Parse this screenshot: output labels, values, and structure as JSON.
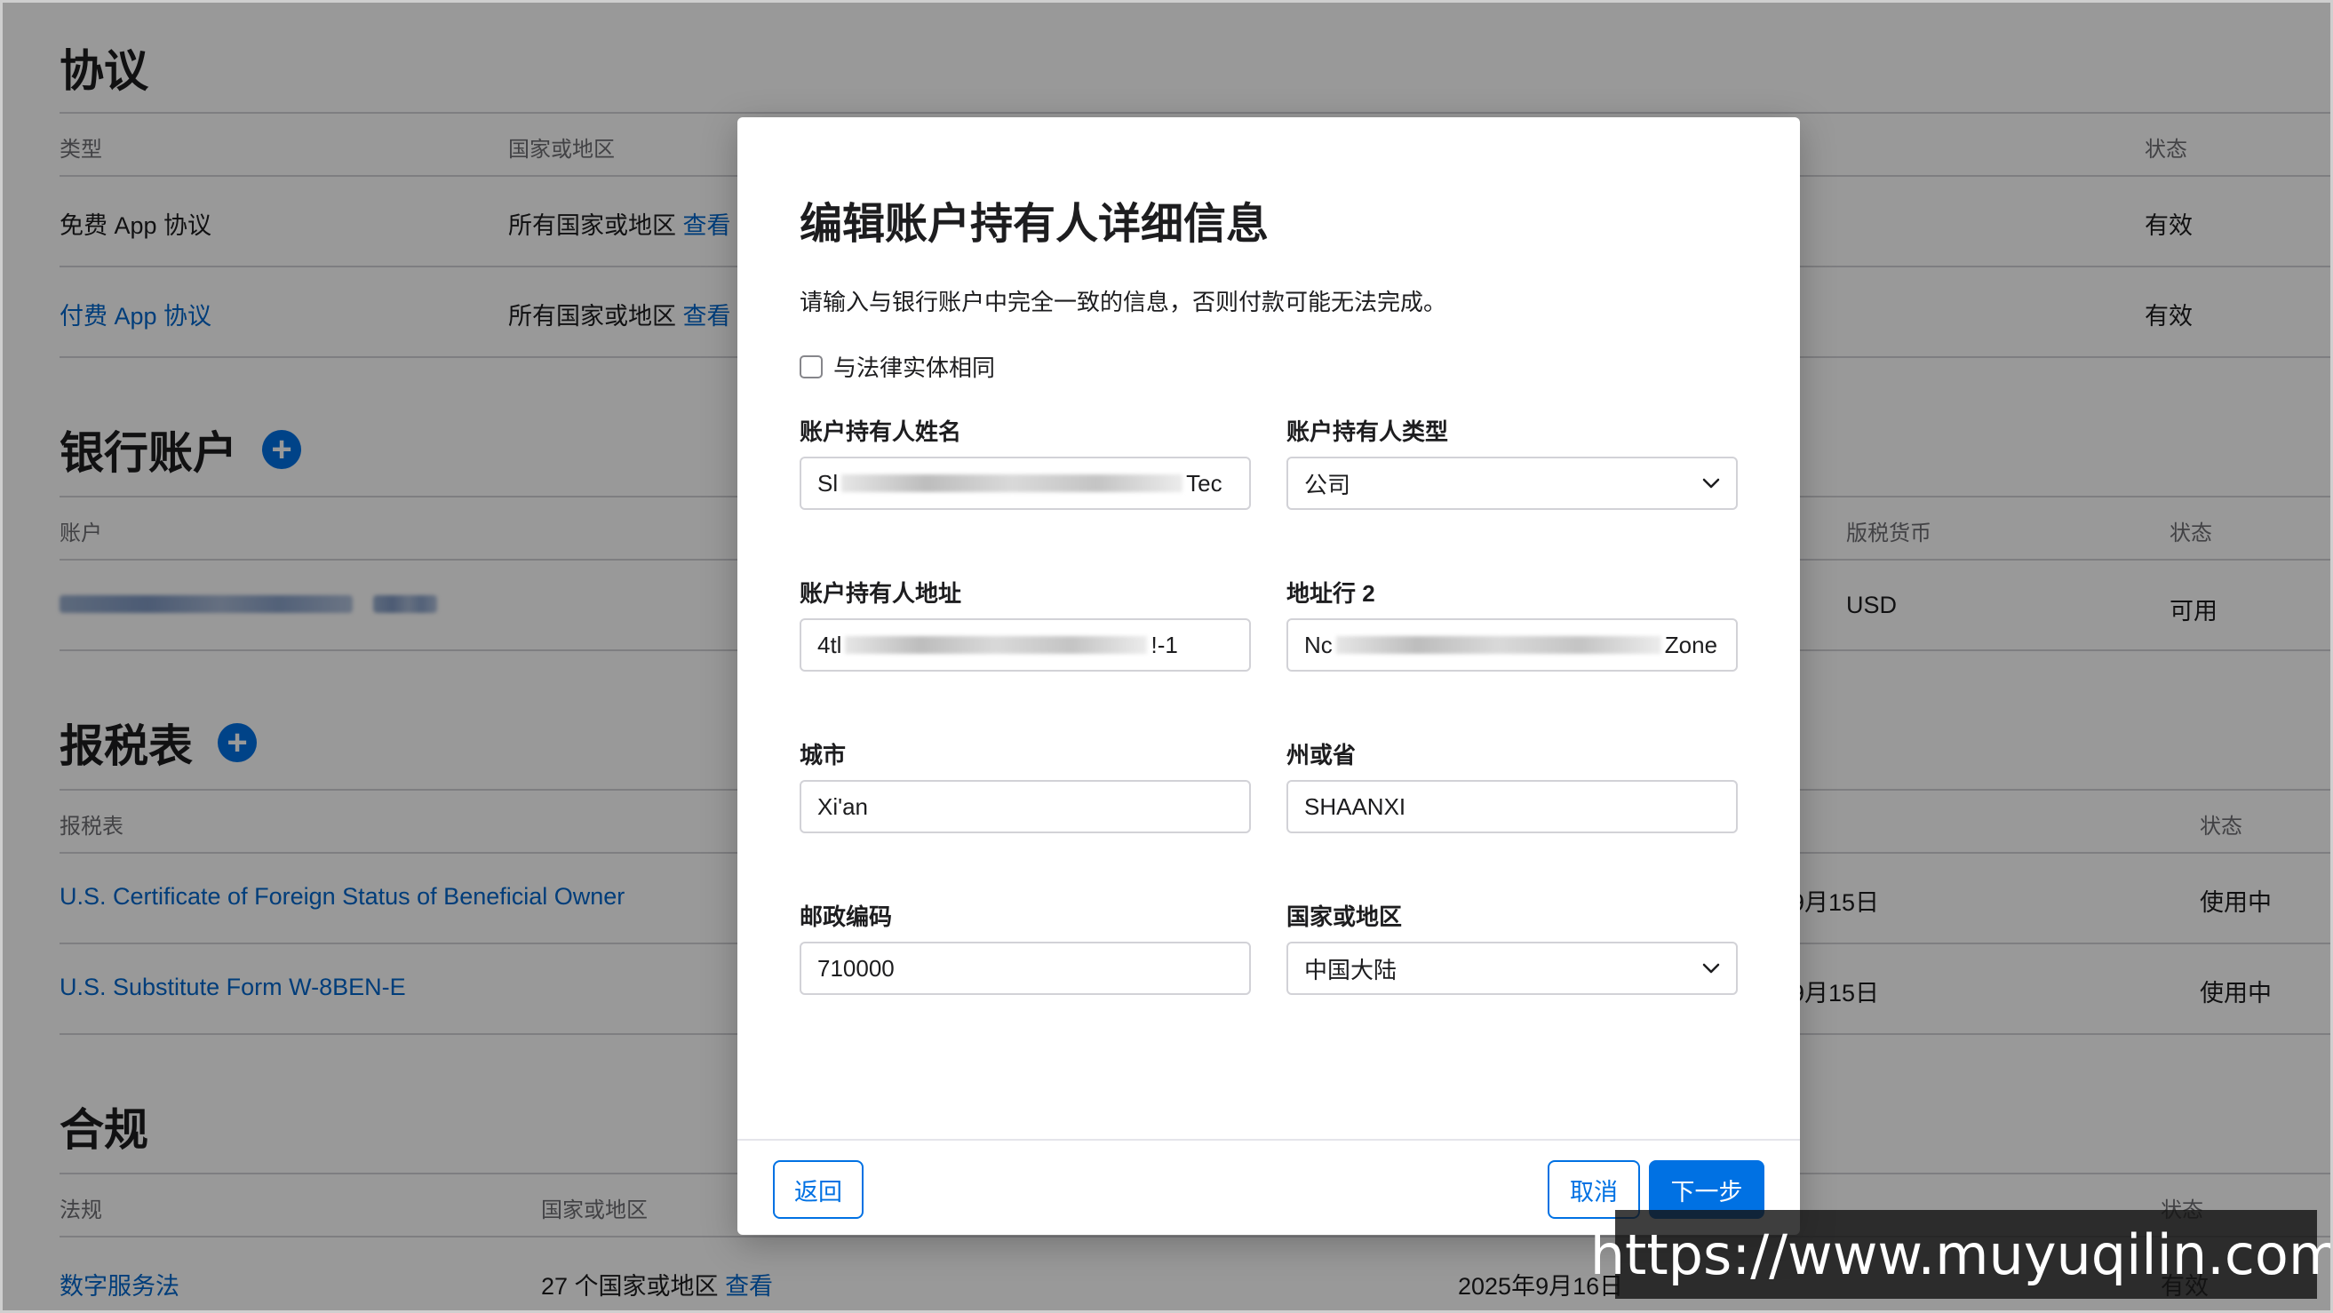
{
  "agreements": {
    "title": "协议",
    "headers": [
      "类型",
      "国家或地区",
      "状态"
    ],
    "rows": [
      {
        "type": "免费 App 协议",
        "region": "所有国家或地区",
        "view": "查看",
        "status": "有效"
      },
      {
        "type": "付费 App 协议",
        "region": "所有国家或地区",
        "view": "查看",
        "status": "有效"
      }
    ]
  },
  "bank": {
    "title": "银行账户",
    "headers": [
      "账户",
      "版税货币",
      "状态"
    ],
    "row": {
      "currency": "USD",
      "status": "可用"
    }
  },
  "tax": {
    "title": "报税表",
    "headers": [
      "报税表",
      "状态"
    ],
    "rows": [
      {
        "name": "U.S. Certificate of Foreign Status of Beneficial Owner",
        "date": "9月15日",
        "status": "使用中"
      },
      {
        "name": "U.S. Substitute Form W-8BEN-E",
        "date": "9月15日",
        "status": "使用中"
      }
    ]
  },
  "compliance": {
    "title": "合规",
    "headers": [
      "法规",
      "国家或地区",
      "状态"
    ],
    "row": {
      "name": "数字服务法",
      "region": "27 个国家或地区",
      "view": "查看",
      "date": "2025年9月16日",
      "status": "有效"
    }
  },
  "modal": {
    "title": "编辑账户持有人详细信息",
    "description": "请输入与银行账户中完全一致的信息，否则付款可能无法完成。",
    "checkbox_label": "与法律实体相同",
    "fields": {
      "holder_name": {
        "label": "账户持有人姓名",
        "prefix": "Sl",
        "suffix": "Tec"
      },
      "holder_type": {
        "label": "账户持有人类型",
        "value": "公司"
      },
      "address": {
        "label": "账户持有人地址",
        "prefix": "4tl",
        "suffix": "!-1"
      },
      "address2": {
        "label": "地址行 2",
        "prefix": "Nc",
        "suffix": "Zone"
      },
      "city": {
        "label": "城市",
        "value": "Xi'an"
      },
      "state": {
        "label": "州或省",
        "value": "SHAANXI"
      },
      "postal": {
        "label": "邮政编码",
        "value": "710000"
      },
      "country": {
        "label": "国家或地区",
        "value": "中国大陆"
      }
    },
    "buttons": {
      "back": "返回",
      "cancel": "取消",
      "next": "下一步"
    }
  },
  "watermark": "https://www.muyuqilin.com",
  "colors": {
    "accent": "#0071e3",
    "link": "#0066cc",
    "text": "#1d1d1f",
    "secondary": "#6e6e73"
  }
}
